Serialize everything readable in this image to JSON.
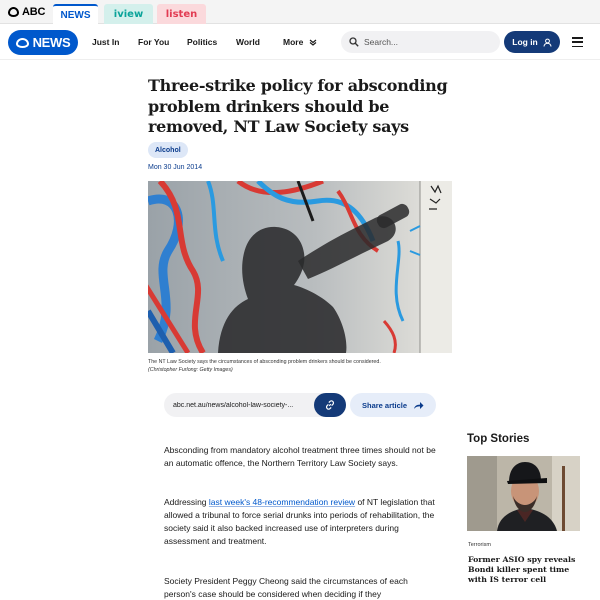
{
  "network": {
    "brand": "ABC",
    "tabs": [
      {
        "label": "NEWS"
      },
      {
        "label": "iview"
      },
      {
        "label": "listen"
      }
    ]
  },
  "header": {
    "logo_text": "NEWS",
    "nav": [
      "Just In",
      "For You",
      "Politics",
      "World",
      "More"
    ],
    "search_placeholder": "Search...",
    "login_label": "Log in"
  },
  "article": {
    "headline": "Three-strike policy for absconding problem drinkers should be removed, NT Law Society says",
    "tag": "Alcohol",
    "date": "Mon 30 Jun 2014",
    "caption": "The NT Law Society says the circumstances of absconding problem drinkers should be considered.",
    "credit": "(Christopher Furlong: Getty Images)",
    "share_url": "abc.net.au/news/alcohol-law-society-...",
    "share_label": "Share article",
    "paragraphs": {
      "p1": "Absconding from mandatory alcohol treatment three times should not be an automatic offence, the Northern Territory Law Society says.",
      "p2_before": "Addressing ",
      "p2_link": "last week's 48-recommendation review",
      "p2_after": " of NT legislation that allowed a tribunal to force serial drunks into periods of rehabilitation, the society said it also backed increased use of interpreters during assessment and treatment.",
      "p3": "Society President Peggy Cheong said the circumstances of each person's case should be considered when deciding if they"
    }
  },
  "top_stories": {
    "title": "Top Stories",
    "items": [
      {
        "category": "Terrorism",
        "headline": "Former ASIO spy reveals Bondi killer spent time with IS terror cell"
      }
    ]
  },
  "colors": {
    "brand_blue": "#0058cc",
    "navy": "#143a78",
    "iview": "#0aa39a",
    "listen": "#e23b52"
  }
}
